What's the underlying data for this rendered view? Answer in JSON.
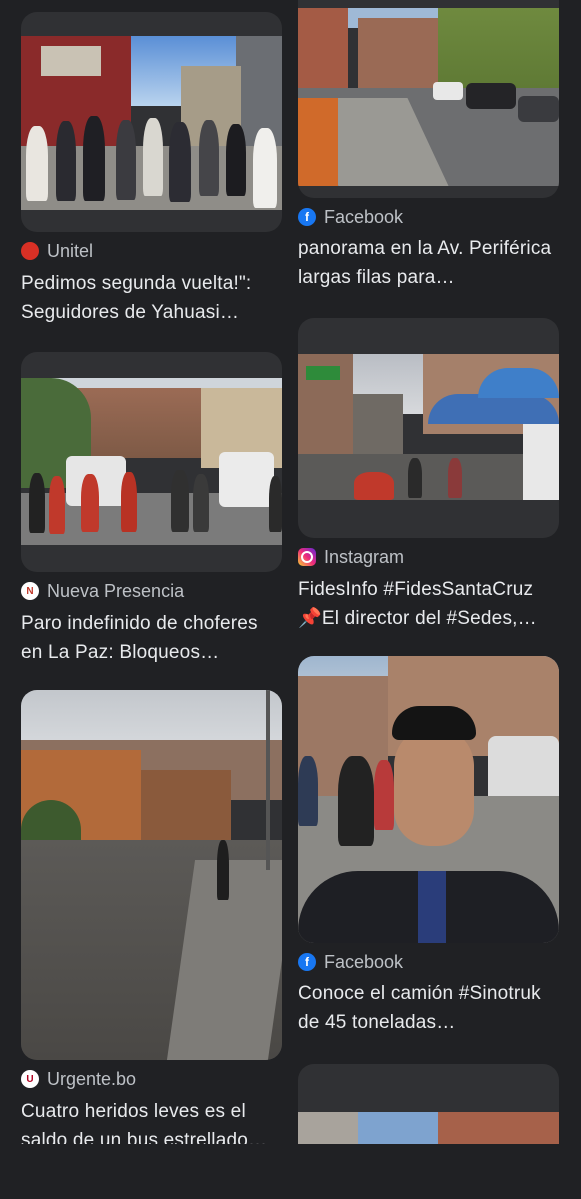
{
  "cards": [
    {
      "id": "unitel",
      "source": "Unitel",
      "source_icon": "unitel-icon",
      "title": "Pedimos segunda vuelta!\": Seguidores de Yahuasi…"
    },
    {
      "id": "nueva",
      "source": "Nueva Presencia",
      "source_icon": "nueva-presencia-icon",
      "title": "Paro indefinido de choferes en La Paz: Bloqueos…"
    },
    {
      "id": "urgente",
      "source": "Urgente.bo",
      "source_icon": "urgente-bo-icon",
      "title": "Cuatro heridos leves es el saldo de un bus estrellado…"
    },
    {
      "id": "fb1",
      "source": "Facebook",
      "source_icon": "facebook-icon",
      "title": "panorama en la Av. Periférica largas filas para…"
    },
    {
      "id": "ig",
      "source": "Instagram",
      "source_icon": "instagram-icon",
      "title": "FidesInfo #FidesSantaCruz 📌El director del #Sedes,…"
    },
    {
      "id": "fb2",
      "source": "Facebook",
      "source_icon": "facebook-icon",
      "title": "Conoce el camión #Sinotruk de 45 toneladas…"
    }
  ],
  "colors": {
    "background": "#202124",
    "card": "#303134",
    "text": "#e8eaed",
    "source_text": "#bdc1c6",
    "facebook": "#1877f2",
    "unitel": "#d93025"
  }
}
